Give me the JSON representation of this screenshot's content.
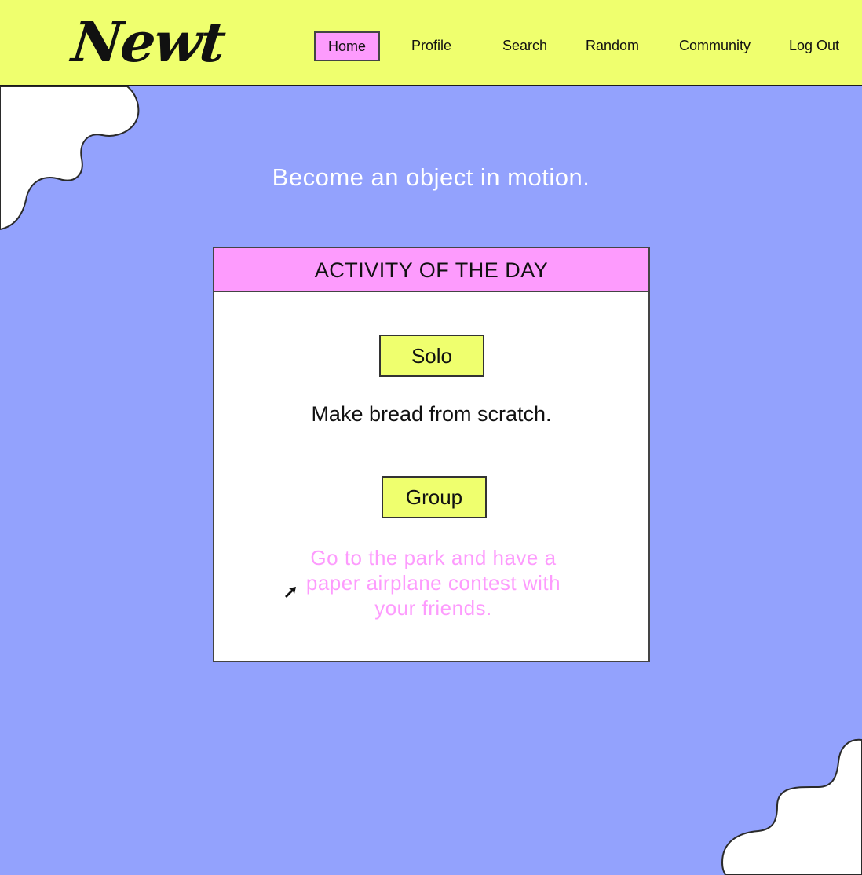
{
  "brand": {
    "logo_text": "Newt"
  },
  "nav": {
    "items": [
      {
        "label": "Home",
        "active": true
      },
      {
        "label": "Profile",
        "active": false
      },
      {
        "label": "Search",
        "active": false
      },
      {
        "label": "Random",
        "active": false
      },
      {
        "label": "Community",
        "active": false
      },
      {
        "label": "Log Out",
        "active": false
      }
    ]
  },
  "hero": {
    "tagline": "Become an object in motion."
  },
  "activity": {
    "header": "ACTIVITY OF THE DAY",
    "solo_label": "Solo",
    "solo_text": "Make bread from scratch.",
    "group_label": "Group",
    "group_text": "Go to the park and have a paper airplane contest with your friends."
  },
  "colors": {
    "background": "#93a2fd",
    "header": "#efff6e",
    "accent_pink": "#fd9bfd",
    "accent_yellow": "#efff6e"
  },
  "icons": {
    "cursor": "cursor-arrow-icon"
  }
}
